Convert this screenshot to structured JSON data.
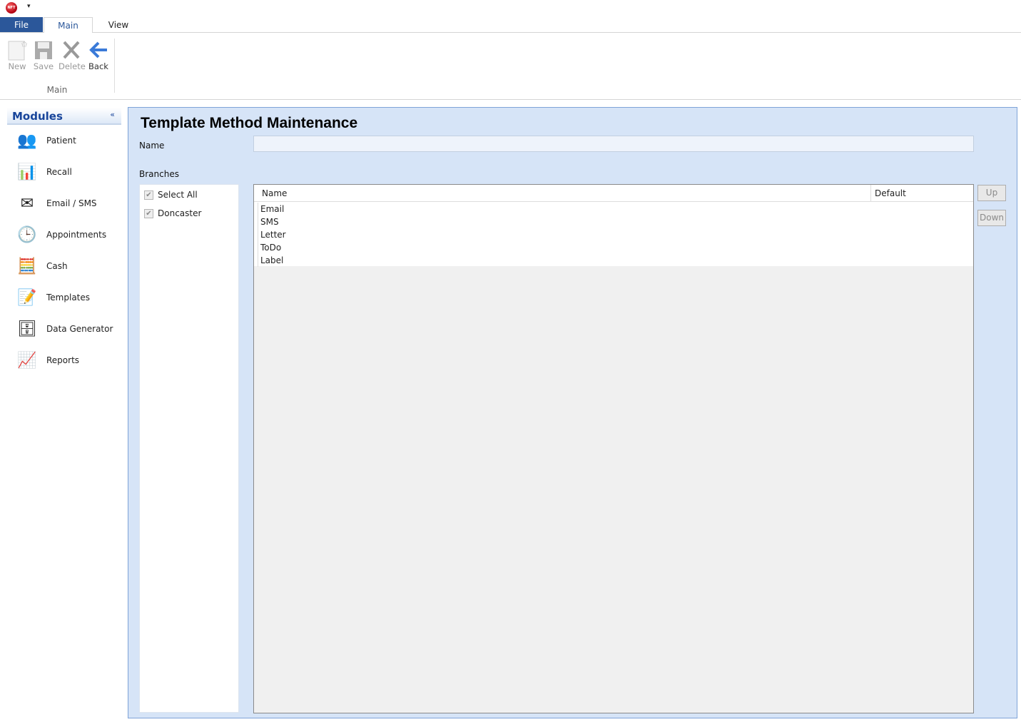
{
  "app": {
    "logo_text": "NFT",
    "quick_access": "▾"
  },
  "tabs": [
    {
      "label": "File"
    },
    {
      "label": "Main"
    },
    {
      "label": "View"
    }
  ],
  "ribbon": {
    "buttons": [
      {
        "label": "New",
        "icon": "new-document-icon",
        "enabled": false
      },
      {
        "label": "Save",
        "icon": "floppy-disk-icon",
        "enabled": false
      },
      {
        "label": "Delete",
        "icon": "x-delete-icon",
        "enabled": false
      },
      {
        "label": "Back",
        "icon": "back-arrow-icon",
        "enabled": true
      }
    ],
    "group_label": "Main"
  },
  "sidebar": {
    "title": "Modules",
    "collapse": "«",
    "items": [
      {
        "label": "Patient",
        "icon": "👥"
      },
      {
        "label": "Recall",
        "icon": "📊"
      },
      {
        "label": "Email / SMS",
        "icon": "✉"
      },
      {
        "label": "Appointments",
        "icon": "🕒"
      },
      {
        "label": "Cash",
        "icon": "🧮"
      },
      {
        "label": "Templates",
        "icon": "📝"
      },
      {
        "label": "Data Generator",
        "icon": "🗄"
      },
      {
        "label": "Reports",
        "icon": "📈"
      }
    ]
  },
  "main": {
    "title": "Template Method Maintenance",
    "name_label": "Name",
    "name_value": "",
    "branches_label": "Branches",
    "branches": [
      {
        "label": "Select All",
        "checked": true
      },
      {
        "label": "Doncaster",
        "checked": true
      }
    ],
    "grid": {
      "columns": [
        "Name",
        "Default"
      ],
      "rows": [
        "Email",
        "SMS",
        "Letter",
        "ToDo",
        "Label"
      ]
    },
    "up_label": "Up",
    "down_label": "Down"
  },
  "colors": {
    "file_tab": "#2b579a",
    "panel_bg": "#d6e4f7",
    "accent": "#17449a"
  }
}
